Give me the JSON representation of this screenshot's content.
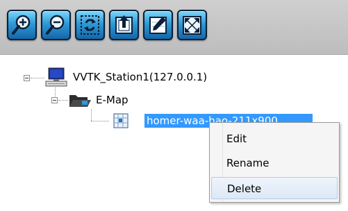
{
  "toolbar": {
    "buttons": [
      {
        "name": "zoom-in-button",
        "icon": "zoom-in-icon"
      },
      {
        "name": "zoom-out-button",
        "icon": "zoom-out-icon"
      },
      {
        "name": "refresh-button",
        "icon": "refresh-icon"
      },
      {
        "name": "upload-map-button",
        "icon": "upload-icon"
      },
      {
        "name": "edit-map-button",
        "icon": "edit-icon"
      },
      {
        "name": "fit-screen-button",
        "icon": "fullscreen-icon"
      }
    ]
  },
  "tree": {
    "station": {
      "label": "VVTK_Station1(127.0.0.1)",
      "icon": "computer-icon"
    },
    "emap": {
      "label": "E-Map",
      "icon": "folder-open-icon"
    },
    "map_item": {
      "label": "homer-waa-hao-211x900",
      "icon": "map-icon",
      "selected": true
    }
  },
  "context_menu": {
    "items": [
      "Edit",
      "Rename",
      "Delete"
    ],
    "highlighted": "Delete"
  },
  "colors": {
    "selection": "#3399ff",
    "toolbar_button": "#2f9ad6"
  }
}
